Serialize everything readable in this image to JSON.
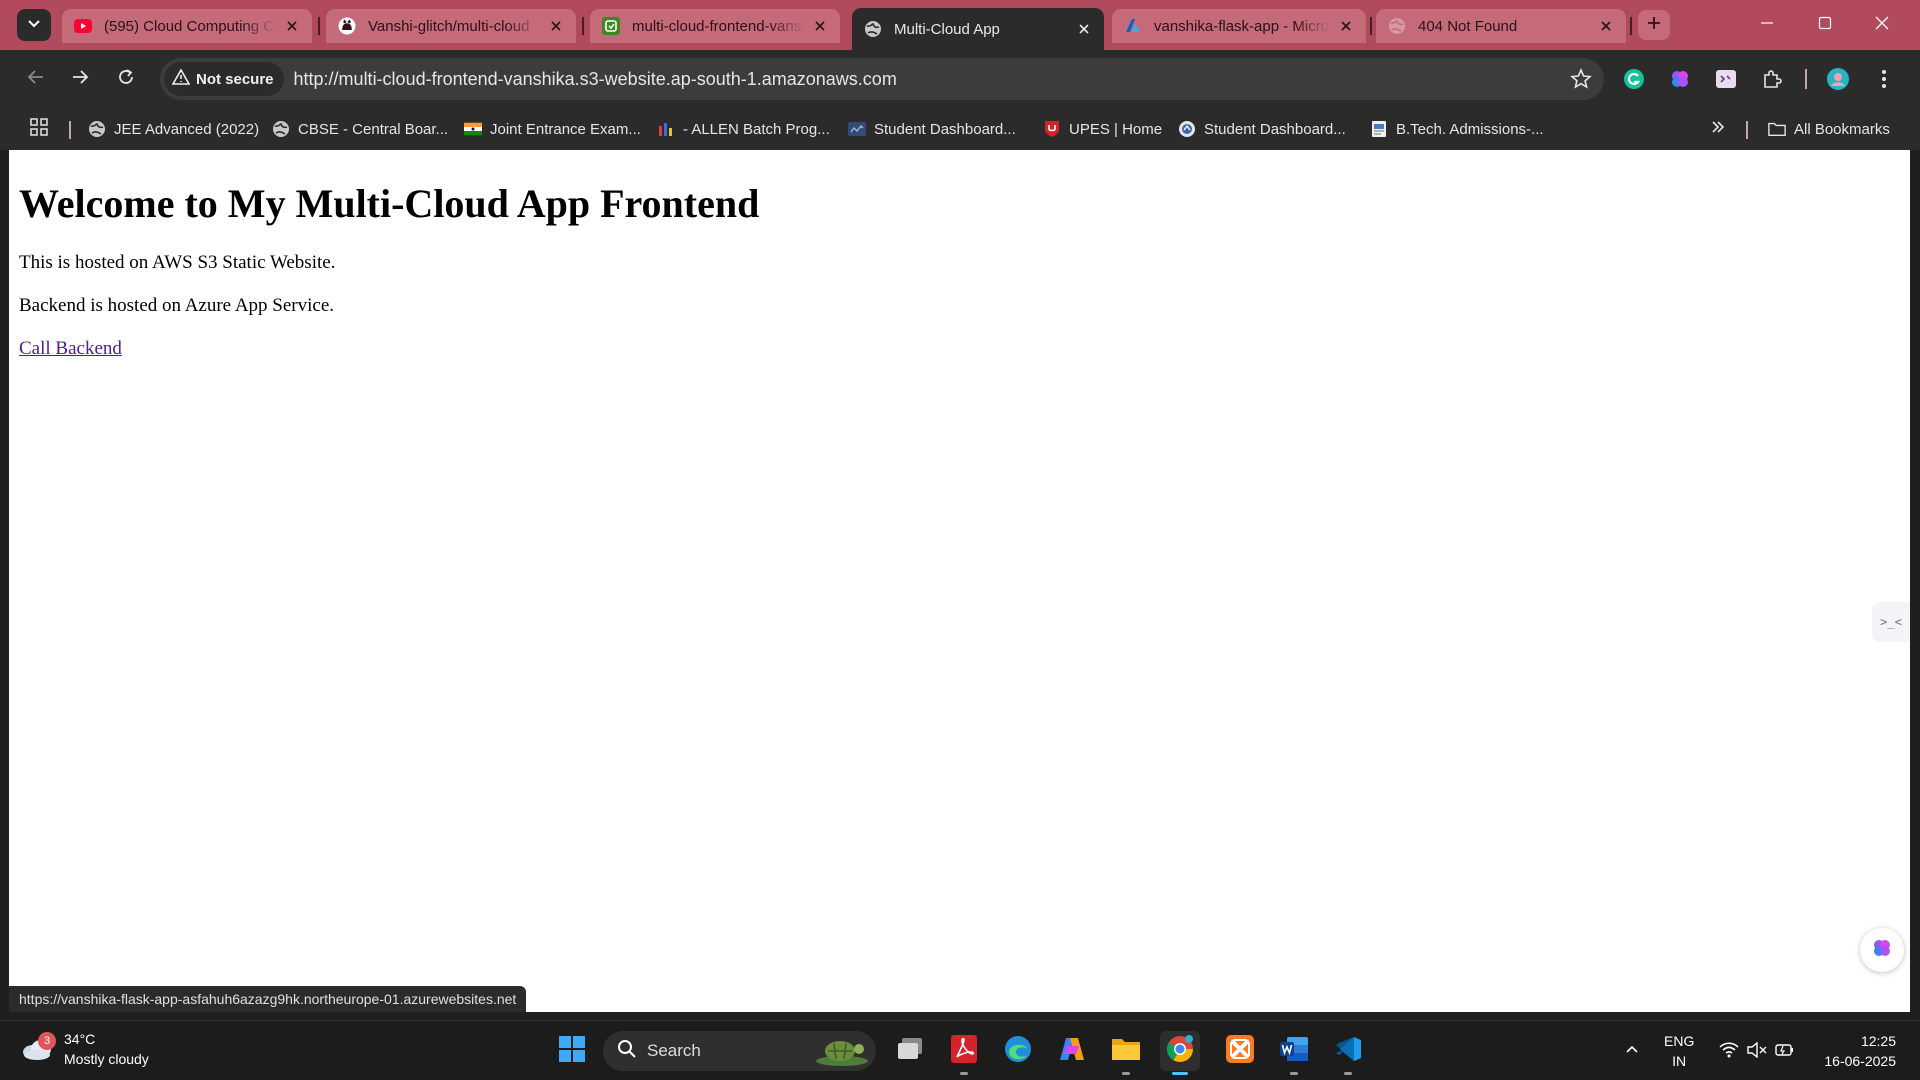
{
  "browser": {
    "tabs": [
      {
        "title": "(595) Cloud Computing Co",
        "icon": "youtube-icon",
        "active": false
      },
      {
        "title": "Vanshi-glitch/multi-cloud",
        "icon": "github-icon",
        "active": false
      },
      {
        "title": "multi-cloud-frontend-vansh",
        "icon": "s3-bucket-icon",
        "active": false
      },
      {
        "title": "Multi-Cloud App",
        "icon": "globe-icon",
        "active": true
      },
      {
        "title": "vanshika-flask-app - Micro",
        "icon": "azure-icon",
        "active": false
      },
      {
        "title": "404 Not Found",
        "icon": "globe-icon",
        "active": false
      }
    ],
    "security_label": "Not secure",
    "url": "http://multi-cloud-frontend-vanshika.s3-website.ap-south-1.amazonaws.com",
    "bookmarks": [
      {
        "label": "JEE Advanced (2022)",
        "icon": "globe-icon"
      },
      {
        "label": "CBSE - Central Boar...",
        "icon": "globe-icon"
      },
      {
        "label": "Joint Entrance Exam...",
        "icon": "india-flag-icon"
      },
      {
        "label": "- ALLEN Batch Prog...",
        "icon": "allen-icon"
      },
      {
        "label": "Student Dashboard...",
        "icon": "dashboard-icon"
      },
      {
        "label": "UPES | Home",
        "icon": "upes-shield-icon"
      },
      {
        "label": "Student Dashboard...",
        "icon": "emblem-icon"
      },
      {
        "label": "B.Tech. Admissions-...",
        "icon": "document-icon"
      }
    ],
    "all_bookmarks_label": "All Bookmarks",
    "status_url": "https://vanshika-flask-app-asfahuh6azazg9hk.northeurope-01.azurewebsites.net",
    "side_panel_glyph": ">_<"
  },
  "page": {
    "heading": "Welcome to My Multi-Cloud App Frontend",
    "paragraph1": "This is hosted on AWS S3 Static Website.",
    "paragraph2": "Backend is hosted on Azure App Service.",
    "link_text": "Call Backend"
  },
  "taskbar": {
    "weather_badge": "3",
    "temperature": "34°C",
    "condition": "Mostly cloudy",
    "search_label": "Search",
    "lang_top": "ENG",
    "lang_bottom": "IN",
    "time": "12:25",
    "date": "16-06-2025"
  },
  "colors": {
    "tab_strip": "#b04a5c",
    "toolbar": "#2b2b2b",
    "link_visited": "#551a8b",
    "taskbar": "#1c1c1c"
  }
}
